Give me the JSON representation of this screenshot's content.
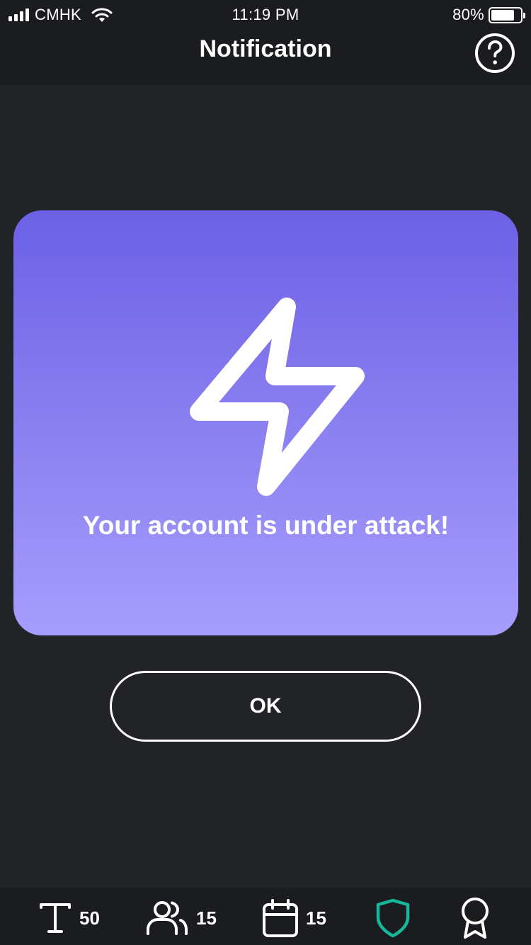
{
  "status_bar": {
    "carrier": "CMHK",
    "time": "11:19 PM",
    "battery": "80%",
    "battery_level": 0.8
  },
  "header": {
    "title": "Notification",
    "help_icon": "question-circle-icon"
  },
  "alert": {
    "icon": "lightning-bolt-icon",
    "message": "Your account is under attack!"
  },
  "actions": {
    "ok_label": "OK"
  },
  "tab_bar": {
    "items": [
      {
        "icon": "text-icon",
        "count": "50"
      },
      {
        "icon": "users-icon",
        "count": "15"
      },
      {
        "icon": "calendar-icon",
        "count": "15"
      },
      {
        "icon": "shield-icon",
        "count": "",
        "active": true
      },
      {
        "icon": "award-icon",
        "count": ""
      }
    ]
  },
  "colors": {
    "background": "#222327",
    "bar_background": "#1b1c1f",
    "card_gradient_top": "#6c60e6",
    "card_gradient_bottom": "#a69dfd",
    "active_tab": "#17b899",
    "text": "#ffffff"
  }
}
